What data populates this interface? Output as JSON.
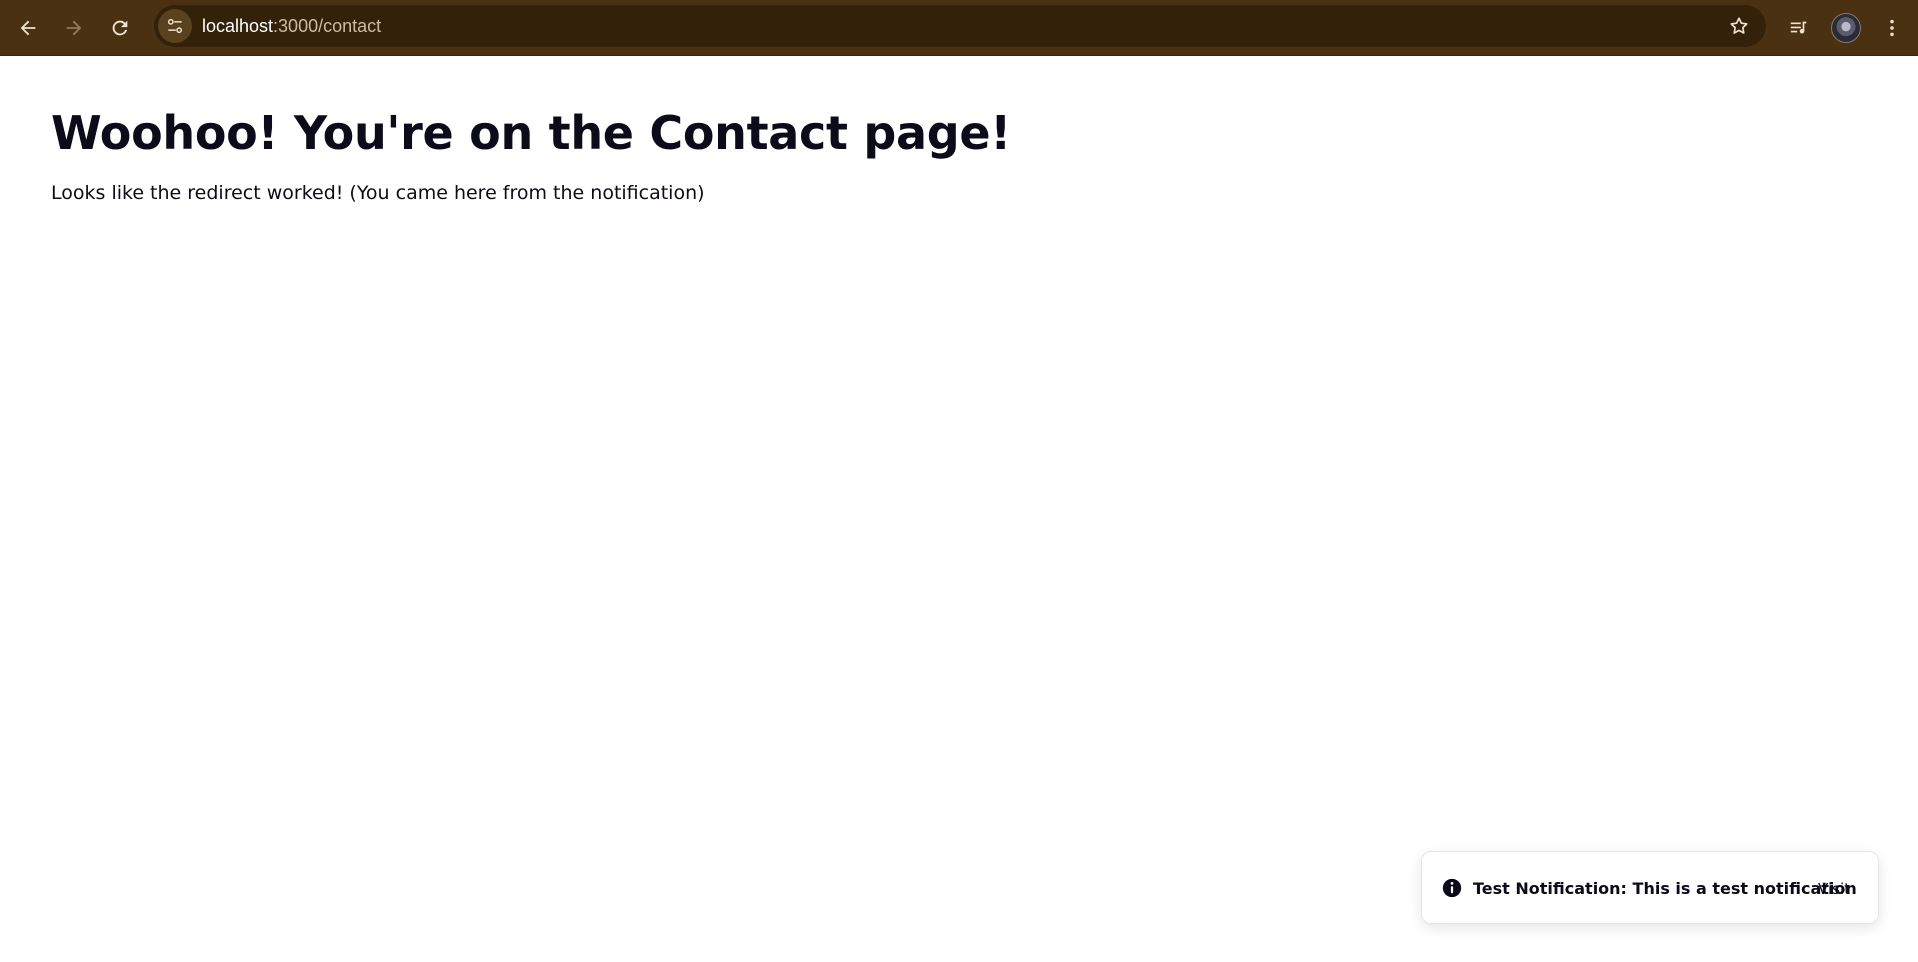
{
  "browser": {
    "url_host": "localhost",
    "url_path": ":3000/contact",
    "icons": {
      "back": "arrow-left-icon",
      "forward": "arrow-right-icon",
      "reload": "reload-icon",
      "site_info": "tune-icon",
      "bookmark": "star-icon",
      "reading_list": "playlist-icon",
      "profile": "avatar",
      "menu": "kebab-menu-icon"
    },
    "colors": {
      "frame": "#4a3112",
      "omnibox": "#33210a"
    }
  },
  "page": {
    "headline": "Woohoo! You're on the Contact page!",
    "subtext": "Looks like the redirect worked! (You came here from the notification)"
  },
  "toast": {
    "icon": "info-icon",
    "message": "Test Notification: This is a test notification",
    "action_label": "Visit"
  }
}
